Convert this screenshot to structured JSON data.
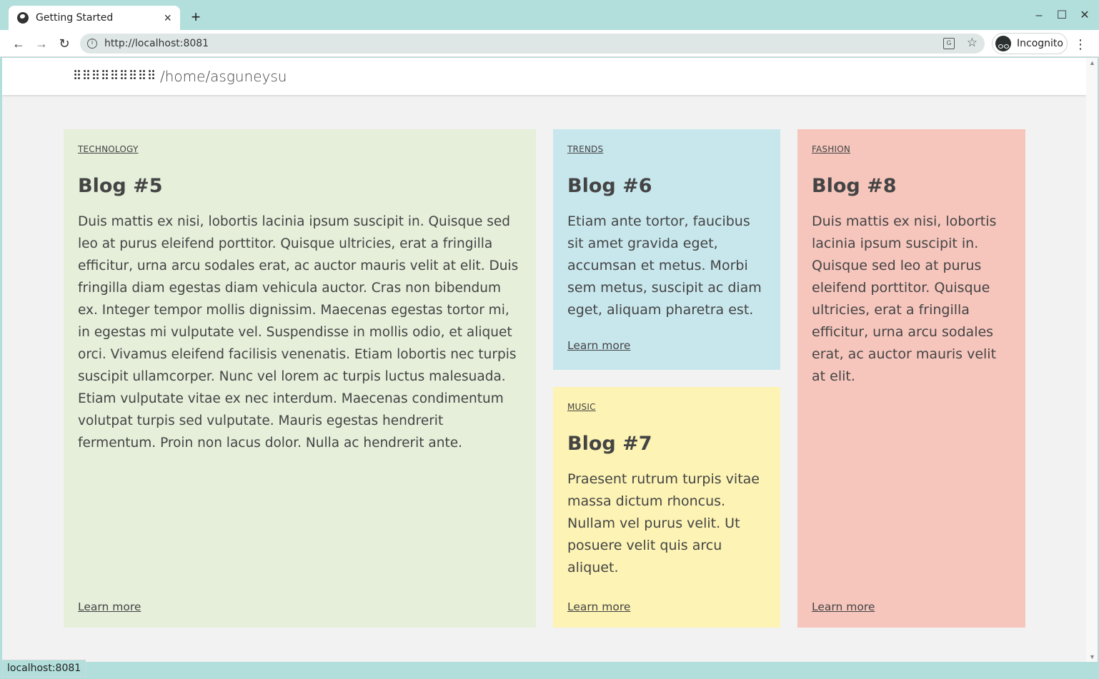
{
  "browser": {
    "tab_title": "Getting Started",
    "url": "http://localhost:8081",
    "profile_label": "Incognito",
    "status_text": "localhost:8081"
  },
  "site": {
    "path": "/home/asguneysu"
  },
  "cards": [
    {
      "category": "TECHNOLOGY",
      "title": "Blog #5",
      "body": "Duis mattis ex nisi, lobortis lacinia ipsum suscipit in. Quisque sed leo at purus eleifend porttitor. Quisque ultricies, erat a fringilla efficitur, urna arcu sodales erat, ac auctor mauris velit at elit. Duis fringilla diam egestas diam vehicula auctor. Cras non bibendum ex. Integer tempor mollis dignissim. Maecenas egestas tortor mi, in egestas mi vulputate vel. Suspendisse in mollis odio, et aliquet orci. Vivamus eleifend facilisis venenatis. Etiam lobortis nec turpis suscipit ullamcorper. Nunc vel lorem ac turpis luctus malesuada. Etiam vulputate vitae ex nec interdum. Maecenas condimentum volutpat turpis sed vulputate. Mauris egestas hendrerit fermentum. Proin non lacus dolor. Nulla ac hendrerit ante.",
      "link": "Learn more",
      "color": "#e5efda"
    },
    {
      "category": "TRENDS",
      "title": "Blog #6",
      "body": "Etiam ante tortor, faucibus sit amet gravida eget, accumsan et metus. Morbi sem metus, suscipit ac diam eget, aliquam pharetra est.",
      "link": "Learn more",
      "color": "#c8e7ed"
    },
    {
      "category": "MUSIC",
      "title": "Blog #7",
      "body": "Praesent rutrum turpis vitae massa dictum rhoncus. Nullam vel purus velit. Ut posuere velit quis arcu aliquet.",
      "link": "Learn more",
      "color": "#fcf3b4"
    },
    {
      "category": "FASHION",
      "title": "Blog #8",
      "body": "Duis mattis ex nisi, lobortis lacinia ipsum suscipit in. Quisque sed leo at purus eleifend porttitor. Quisque ultricies, erat a fringilla efficitur, urna arcu sodales erat, ac auctor mauris velit at elit.",
      "link": "Learn more",
      "color": "#f6c6bd"
    }
  ],
  "icons": {
    "tab": "globe-icon",
    "close": "close-icon",
    "new_tab": "plus-icon",
    "back": "back-arrow-icon",
    "forward": "forward-arrow-icon",
    "reload": "reload-icon",
    "info": "info-icon",
    "translate": "translate-icon",
    "bookmark": "star-icon",
    "incognito": "incognito-icon",
    "menu": "kebab-menu-icon"
  }
}
